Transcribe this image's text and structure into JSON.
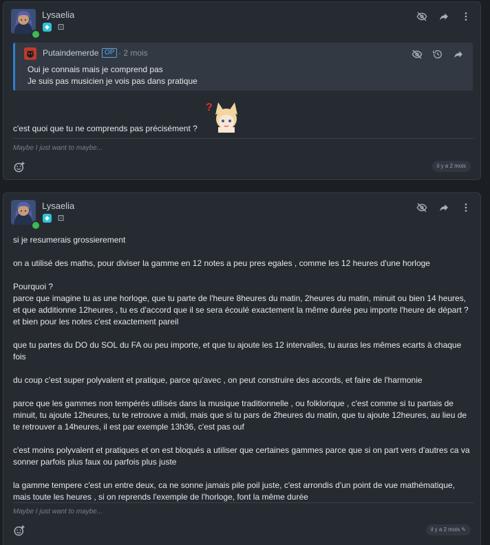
{
  "post1": {
    "username": "Lysaelia",
    "quote": {
      "author": "Putaindemerde",
      "op_badge": "OP",
      "time": "· 2 mois",
      "lines": [
        "Oui je connais mais je comprend pas",
        "Je suis pas musicien je vois pas dans pratique"
      ]
    },
    "text": "c'est quoi que tu ne comprends pas précisément ?",
    "signature": "Maybe I just want to maybe...",
    "timestamp": "il y a 2 mois"
  },
  "post2": {
    "username": "Lysaelia",
    "paragraphs": [
      "si je resumerais grossierement",
      "on a utilisé des maths, pour diviser la gamme en 12 notes a peu pres egales , comme les 12 heures d'une horloge",
      "Pourquoi ?",
      "parce que imagine tu as une horloge, que tu parte de l'heure 8heures du matin, 2heures du matin, minuit ou bien 14 heures, et que additionne 12heures , tu es d'accord que il se sera écoulé exactement la même durée peu importe l'heure de départ ? et bien pour les notes c'est exactement pareil",
      "que tu partes du DO du SOL du FA ou peu importe, et que tu ajoute les 12 intervalles, tu auras les mêmes ecarts à chaque fois",
      "du coup c'est super polyvalent et pratique, parce qu'avec , on peut construire des accords, et faire de l'harmonie",
      "parce que les gammes non tempérés utilisés dans la musique traditionnelle , ou folklorique , c'est comme si tu partais de minuit, tu ajoute 12heures, tu te retrouve a midi, mais que si tu pars de 2heures du matin, que tu ajoute 12heures, au lieu de te retrouver a 14heures, il est par exemple 13h36, c'est pas ouf",
      "c'est moins polyvalent et pratiques et on est bloqués a utiliser que certaines gammes parce que si on part vers d'autres ca va sonner parfois plus faux ou parfois plus juste",
      "la gamme tempere c'est un entre deux, ca ne sonne jamais pile poil juste, c'est arrondis d'un point de vue mathématique, mais toute les heures , si on reprends l'exemple de l'horloge, font la même durée"
    ],
    "signature": "Maybe I just want to maybe...",
    "timestamp": "il y a 2 mois"
  },
  "icons": {
    "hide": "eye-slash-icon",
    "share": "share-arrow-icon",
    "more": "more-vertical-icon",
    "history": "history-icon",
    "react": "add-reaction-icon",
    "edited": "pencil-icon"
  },
  "colors": {
    "background": "#1b1f24",
    "card": "#262b32",
    "quote": "#323942",
    "quote_border": "#2f80d0",
    "online": "#3fb950",
    "op": "#5aa3e6"
  }
}
